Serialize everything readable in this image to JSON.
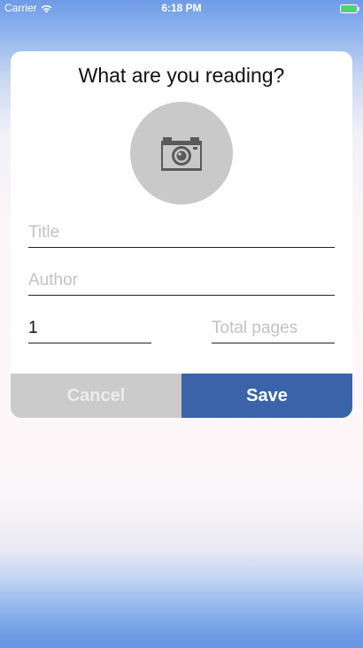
{
  "status_bar": {
    "carrier": "Carrier",
    "time": "6:18 PM",
    "wifi_icon": "wifi-icon",
    "battery_icon": "battery-full-icon"
  },
  "dialog": {
    "title": "What are you reading?",
    "photo_icon": "camera-icon",
    "fields": {
      "title": {
        "value": "",
        "placeholder": "Title"
      },
      "author": {
        "value": "",
        "placeholder": "Author"
      },
      "current_page": {
        "value": "1",
        "placeholder": ""
      },
      "total_pages": {
        "value": "",
        "placeholder": "Total pages"
      }
    },
    "cancel_label": "Cancel",
    "save_label": "Save"
  },
  "colors": {
    "save_button": "#3a63aa",
    "cancel_button": "#cbcbcb",
    "battery": "#4cd964"
  }
}
